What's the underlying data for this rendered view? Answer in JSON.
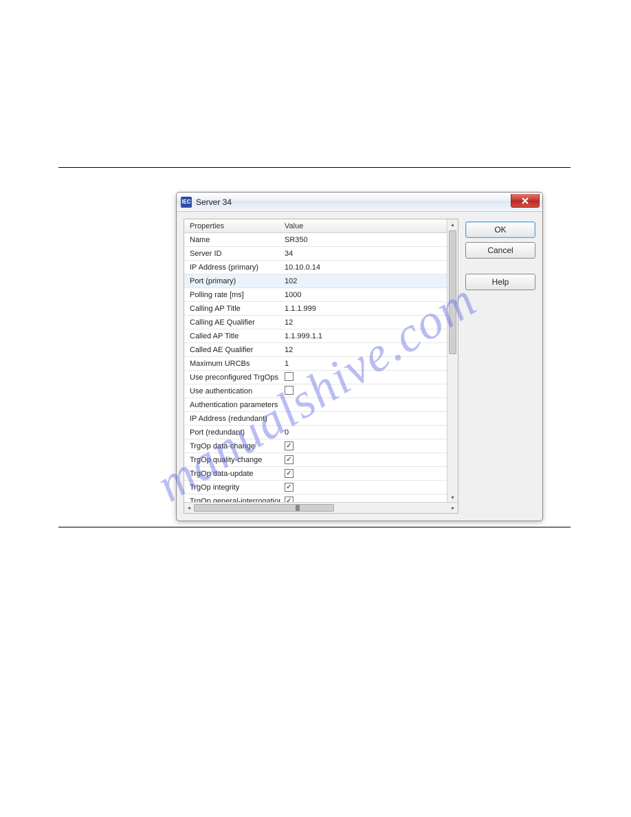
{
  "window": {
    "title": "Server 34",
    "app_icon_text": "IEC"
  },
  "buttons": {
    "ok": "OK",
    "cancel": "Cancel",
    "help": "Help"
  },
  "grid": {
    "header_prop": "Properties",
    "header_val": "Value",
    "rows": [
      {
        "prop": "Name",
        "val": "SR350"
      },
      {
        "prop": "Server ID",
        "val": "34"
      },
      {
        "prop": "IP Address (primary)",
        "val": "10.10.0.14"
      },
      {
        "prop": "Port (primary)",
        "val": "102",
        "selected": true
      },
      {
        "prop": "Polling rate [ms]",
        "val": "1000"
      },
      {
        "prop": "Calling AP Title",
        "val": "1.1.1.999"
      },
      {
        "prop": "Calling AE Qualifier",
        "val": "12"
      },
      {
        "prop": "Called AP Title",
        "val": "1.1.999.1.1"
      },
      {
        "prop": "Called AE Qualifier",
        "val": "12"
      },
      {
        "prop": "Maximum URCBs",
        "val": "1"
      },
      {
        "prop": "Use preconfigured TrgOps",
        "checkbox": true,
        "checked": false
      },
      {
        "prop": "Use authentication",
        "checkbox": true,
        "checked": false
      },
      {
        "prop": "Authentication parameters",
        "val": ""
      },
      {
        "prop": "IP Address (redundant)",
        "val": ""
      },
      {
        "prop": "Port (redundant)",
        "val": "0"
      },
      {
        "prop": "TrgOp data-change",
        "checkbox": true,
        "checked": true
      },
      {
        "prop": "TrgOp quality-change",
        "checkbox": true,
        "checked": true
      },
      {
        "prop": "TrgOp data-update",
        "checkbox": true,
        "checked": true
      },
      {
        "prop": "TrgOp integrity",
        "checkbox": true,
        "checked": true
      },
      {
        "prop": "TrgOp general-interrogation",
        "checkbox": true,
        "checked": true
      }
    ]
  },
  "watermark": "manualshive.com"
}
